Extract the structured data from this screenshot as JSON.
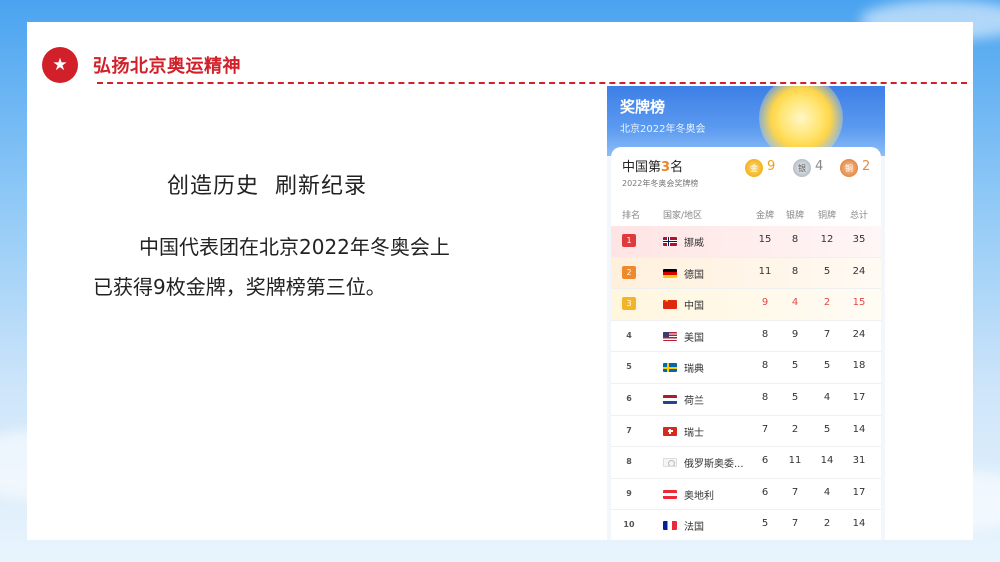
{
  "slide": {
    "section_title": "弘扬北京奥运精神",
    "subheading": "创造历史  刷新纪录",
    "body": "中国代表团在北京2022年冬奥会上已获得9枚金牌，奖牌榜第三位。"
  },
  "panel": {
    "title": "奖牌榜",
    "subtitle": "北京2022年冬奥会",
    "summary": {
      "title_prefix": "中国第",
      "rank": "3",
      "title_suffix": "名",
      "subtitle": "2022年冬奥会奖牌榜",
      "gold_label": "金",
      "silver_label": "银",
      "bronze_label": "铜",
      "gold": "9",
      "silver": "4",
      "bronze": "2"
    },
    "headers": {
      "rank": "排名",
      "nation": "国家/地区",
      "gold": "金牌",
      "silver": "银牌",
      "bronze": "铜牌",
      "total": "总计"
    },
    "rows": [
      {
        "rank": "1",
        "flag": "no",
        "name": "挪威",
        "gold": "15",
        "silver": "8",
        "bronze": "12",
        "total": "35"
      },
      {
        "rank": "2",
        "flag": "de",
        "name": "德国",
        "gold": "11",
        "silver": "8",
        "bronze": "5",
        "total": "24"
      },
      {
        "rank": "3",
        "flag": "cn",
        "name": "中国",
        "gold": "9",
        "silver": "4",
        "bronze": "2",
        "total": "15"
      },
      {
        "rank": "4",
        "flag": "us",
        "name": "美国",
        "gold": "8",
        "silver": "9",
        "bronze": "7",
        "total": "24"
      },
      {
        "rank": "5",
        "flag": "se",
        "name": "瑞典",
        "gold": "8",
        "silver": "5",
        "bronze": "5",
        "total": "18"
      },
      {
        "rank": "6",
        "flag": "nl",
        "name": "荷兰",
        "gold": "8",
        "silver": "5",
        "bronze": "4",
        "total": "17"
      },
      {
        "rank": "7",
        "flag": "ch",
        "name": "瑞士",
        "gold": "7",
        "silver": "2",
        "bronze": "5",
        "total": "14"
      },
      {
        "rank": "8",
        "flag": "roc",
        "name": "俄罗斯奥委...",
        "gold": "6",
        "silver": "11",
        "bronze": "14",
        "total": "31"
      },
      {
        "rank": "9",
        "flag": "at",
        "name": "奥地利",
        "gold": "6",
        "silver": "7",
        "bronze": "4",
        "total": "17"
      },
      {
        "rank": "10",
        "flag": "fr",
        "name": "法国",
        "gold": "5",
        "silver": "7",
        "bronze": "2",
        "total": "14"
      }
    ]
  },
  "colors": {
    "accent": "#d2202a",
    "highlight": "#e24a4a"
  },
  "icons": {
    "badge": "star-icon"
  }
}
